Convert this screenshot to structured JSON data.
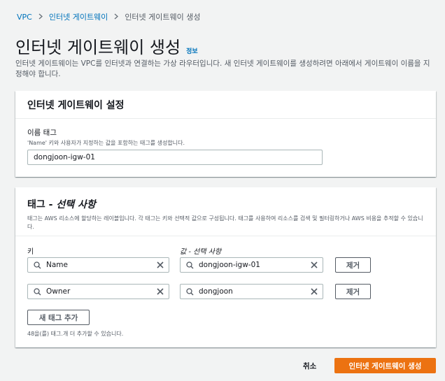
{
  "breadcrumb": {
    "items": [
      "VPC",
      "인터넷 게이트웨이"
    ],
    "current": "인터넷 게이트웨이 생성"
  },
  "page": {
    "title": "인터넷 게이트웨이 생성",
    "info_link": "정보",
    "description": "인터넷 게이트웨이는 VPC를 인터넷과 연결하는 가상 라우터입니다. 새 인터넷 게이트웨이를 생성하려면 아래에서 게이트웨이 이름을 지정해야 합니다."
  },
  "settings": {
    "title": "인터넷 게이트웨이 설정",
    "name_tag_label": "이름 태그",
    "name_tag_hint": "'Name' 키와 사용자가 지정하는 값을 포함하는 태그를 생성합니다.",
    "name_tag_value": "dongjoon-igw-01"
  },
  "tags": {
    "title": "태그 - ",
    "title_optional": "선택 사항",
    "description": "태그는 AWS 리소스에 할당하는 레이블입니다. 각 태그는 키와 선택적 값으로 구성됩니다. 태그를 사용하여 리소스를 검색 및 필터링하거나 AWS 비용을 추적할 수 있습니다.",
    "key_header": "키",
    "value_header": "값 - 선택 사항",
    "rows": [
      {
        "key": "Name",
        "value": "dongjoon-igw-01",
        "remove": "제거"
      },
      {
        "key": "Owner",
        "value": "dongjoon",
        "remove": "제거"
      }
    ],
    "add_button": "새 태그 추가",
    "remaining_hint": "48을(를) 태그.개 더 추가할 수 있습니다."
  },
  "footer": {
    "cancel": "취소",
    "submit": "인터넷 게이트웨이 생성"
  },
  "colors": {
    "link": "#0073bb",
    "primary": "#ec7211",
    "background": "#f2f3f3"
  },
  "icons": {
    "search": "search-icon",
    "clear": "close-icon",
    "separator": "chevron-right-icon"
  }
}
